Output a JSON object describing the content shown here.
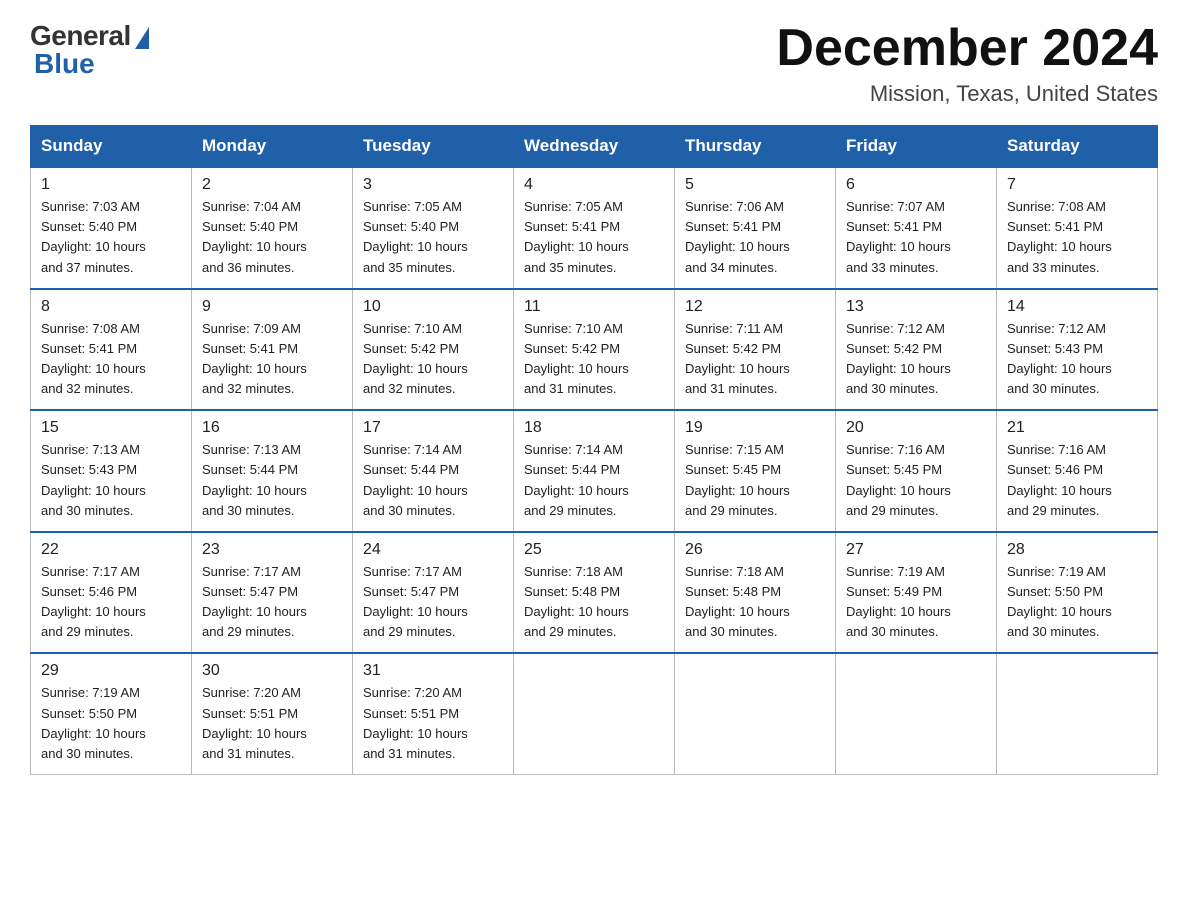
{
  "logo": {
    "general": "General",
    "blue": "Blue"
  },
  "header": {
    "month": "December 2024",
    "location": "Mission, Texas, United States"
  },
  "days_of_week": [
    "Sunday",
    "Monday",
    "Tuesday",
    "Wednesday",
    "Thursday",
    "Friday",
    "Saturday"
  ],
  "weeks": [
    [
      {
        "day": "1",
        "info": "Sunrise: 7:03 AM\nSunset: 5:40 PM\nDaylight: 10 hours\nand 37 minutes."
      },
      {
        "day": "2",
        "info": "Sunrise: 7:04 AM\nSunset: 5:40 PM\nDaylight: 10 hours\nand 36 minutes."
      },
      {
        "day": "3",
        "info": "Sunrise: 7:05 AM\nSunset: 5:40 PM\nDaylight: 10 hours\nand 35 minutes."
      },
      {
        "day": "4",
        "info": "Sunrise: 7:05 AM\nSunset: 5:41 PM\nDaylight: 10 hours\nand 35 minutes."
      },
      {
        "day": "5",
        "info": "Sunrise: 7:06 AM\nSunset: 5:41 PM\nDaylight: 10 hours\nand 34 minutes."
      },
      {
        "day": "6",
        "info": "Sunrise: 7:07 AM\nSunset: 5:41 PM\nDaylight: 10 hours\nand 33 minutes."
      },
      {
        "day": "7",
        "info": "Sunrise: 7:08 AM\nSunset: 5:41 PM\nDaylight: 10 hours\nand 33 minutes."
      }
    ],
    [
      {
        "day": "8",
        "info": "Sunrise: 7:08 AM\nSunset: 5:41 PM\nDaylight: 10 hours\nand 32 minutes."
      },
      {
        "day": "9",
        "info": "Sunrise: 7:09 AM\nSunset: 5:41 PM\nDaylight: 10 hours\nand 32 minutes."
      },
      {
        "day": "10",
        "info": "Sunrise: 7:10 AM\nSunset: 5:42 PM\nDaylight: 10 hours\nand 32 minutes."
      },
      {
        "day": "11",
        "info": "Sunrise: 7:10 AM\nSunset: 5:42 PM\nDaylight: 10 hours\nand 31 minutes."
      },
      {
        "day": "12",
        "info": "Sunrise: 7:11 AM\nSunset: 5:42 PM\nDaylight: 10 hours\nand 31 minutes."
      },
      {
        "day": "13",
        "info": "Sunrise: 7:12 AM\nSunset: 5:42 PM\nDaylight: 10 hours\nand 30 minutes."
      },
      {
        "day": "14",
        "info": "Sunrise: 7:12 AM\nSunset: 5:43 PM\nDaylight: 10 hours\nand 30 minutes."
      }
    ],
    [
      {
        "day": "15",
        "info": "Sunrise: 7:13 AM\nSunset: 5:43 PM\nDaylight: 10 hours\nand 30 minutes."
      },
      {
        "day": "16",
        "info": "Sunrise: 7:13 AM\nSunset: 5:44 PM\nDaylight: 10 hours\nand 30 minutes."
      },
      {
        "day": "17",
        "info": "Sunrise: 7:14 AM\nSunset: 5:44 PM\nDaylight: 10 hours\nand 30 minutes."
      },
      {
        "day": "18",
        "info": "Sunrise: 7:14 AM\nSunset: 5:44 PM\nDaylight: 10 hours\nand 29 minutes."
      },
      {
        "day": "19",
        "info": "Sunrise: 7:15 AM\nSunset: 5:45 PM\nDaylight: 10 hours\nand 29 minutes."
      },
      {
        "day": "20",
        "info": "Sunrise: 7:16 AM\nSunset: 5:45 PM\nDaylight: 10 hours\nand 29 minutes."
      },
      {
        "day": "21",
        "info": "Sunrise: 7:16 AM\nSunset: 5:46 PM\nDaylight: 10 hours\nand 29 minutes."
      }
    ],
    [
      {
        "day": "22",
        "info": "Sunrise: 7:17 AM\nSunset: 5:46 PM\nDaylight: 10 hours\nand 29 minutes."
      },
      {
        "day": "23",
        "info": "Sunrise: 7:17 AM\nSunset: 5:47 PM\nDaylight: 10 hours\nand 29 minutes."
      },
      {
        "day": "24",
        "info": "Sunrise: 7:17 AM\nSunset: 5:47 PM\nDaylight: 10 hours\nand 29 minutes."
      },
      {
        "day": "25",
        "info": "Sunrise: 7:18 AM\nSunset: 5:48 PM\nDaylight: 10 hours\nand 29 minutes."
      },
      {
        "day": "26",
        "info": "Sunrise: 7:18 AM\nSunset: 5:48 PM\nDaylight: 10 hours\nand 30 minutes."
      },
      {
        "day": "27",
        "info": "Sunrise: 7:19 AM\nSunset: 5:49 PM\nDaylight: 10 hours\nand 30 minutes."
      },
      {
        "day": "28",
        "info": "Sunrise: 7:19 AM\nSunset: 5:50 PM\nDaylight: 10 hours\nand 30 minutes."
      }
    ],
    [
      {
        "day": "29",
        "info": "Sunrise: 7:19 AM\nSunset: 5:50 PM\nDaylight: 10 hours\nand 30 minutes."
      },
      {
        "day": "30",
        "info": "Sunrise: 7:20 AM\nSunset: 5:51 PM\nDaylight: 10 hours\nand 31 minutes."
      },
      {
        "day": "31",
        "info": "Sunrise: 7:20 AM\nSunset: 5:51 PM\nDaylight: 10 hours\nand 31 minutes."
      },
      {
        "day": "",
        "info": ""
      },
      {
        "day": "",
        "info": ""
      },
      {
        "day": "",
        "info": ""
      },
      {
        "day": "",
        "info": ""
      }
    ]
  ]
}
